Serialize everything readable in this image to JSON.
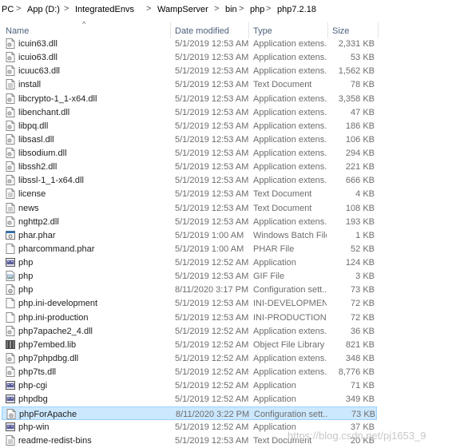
{
  "breadcrumb": [
    "PC",
    "App (D:)",
    "IntegratedEnvs",
    "WampServer",
    "bin",
    "php",
    "php7.2.18"
  ],
  "breadcrumb_separator": ">",
  "columns": {
    "name": "Name",
    "date": "Date modified",
    "type": "Type",
    "size": "Size"
  },
  "sort_indicator": "^",
  "files": [
    {
      "name": "icuin63.dll",
      "date": "5/1/2019 12:53 AM",
      "type": "Application extens...",
      "size": "2,331 KB",
      "icon": "dll-icon"
    },
    {
      "name": "icuio63.dll",
      "date": "5/1/2019 12:53 AM",
      "type": "Application extens...",
      "size": "53 KB",
      "icon": "dll-icon"
    },
    {
      "name": "icuuc63.dll",
      "date": "5/1/2019 12:53 AM",
      "type": "Application extens...",
      "size": "1,562 KB",
      "icon": "dll-icon"
    },
    {
      "name": "install",
      "date": "5/1/2019 12:53 AM",
      "type": "Text Document",
      "size": "78 KB",
      "icon": "text-document-icon"
    },
    {
      "name": "libcrypto-1_1-x64.dll",
      "date": "5/1/2019 12:53 AM",
      "type": "Application extens...",
      "size": "3,358 KB",
      "icon": "dll-icon"
    },
    {
      "name": "libenchant.dll",
      "date": "5/1/2019 12:53 AM",
      "type": "Application extens...",
      "size": "47 KB",
      "icon": "dll-icon"
    },
    {
      "name": "libpq.dll",
      "date": "5/1/2019 12:53 AM",
      "type": "Application extens...",
      "size": "186 KB",
      "icon": "dll-icon"
    },
    {
      "name": "libsasl.dll",
      "date": "5/1/2019 12:53 AM",
      "type": "Application extens...",
      "size": "106 KB",
      "icon": "dll-icon"
    },
    {
      "name": "libsodium.dll",
      "date": "5/1/2019 12:53 AM",
      "type": "Application extens...",
      "size": "294 KB",
      "icon": "dll-icon"
    },
    {
      "name": "libssh2.dll",
      "date": "5/1/2019 12:53 AM",
      "type": "Application extens...",
      "size": "221 KB",
      "icon": "dll-icon"
    },
    {
      "name": "libssl-1_1-x64.dll",
      "date": "5/1/2019 12:53 AM",
      "type": "Application extens...",
      "size": "666 KB",
      "icon": "dll-icon"
    },
    {
      "name": "license",
      "date": "5/1/2019 12:53 AM",
      "type": "Text Document",
      "size": "4 KB",
      "icon": "text-document-icon"
    },
    {
      "name": "news",
      "date": "5/1/2019 12:53 AM",
      "type": "Text Document",
      "size": "108 KB",
      "icon": "text-document-icon"
    },
    {
      "name": "nghttp2.dll",
      "date": "5/1/2019 12:53 AM",
      "type": "Application extens...",
      "size": "193 KB",
      "icon": "dll-icon"
    },
    {
      "name": "phar.phar",
      "date": "5/1/2019 1:00 AM",
      "type": "Windows Batch File",
      "size": "1 KB",
      "icon": "batch-file-icon"
    },
    {
      "name": "pharcommand.phar",
      "date": "5/1/2019 1:00 AM",
      "type": "PHAR File",
      "size": "52 KB",
      "icon": "blank-file-icon"
    },
    {
      "name": "php",
      "date": "5/1/2019 12:52 AM",
      "type": "Application",
      "size": "124 KB",
      "icon": "php-exe-icon"
    },
    {
      "name": "php",
      "date": "5/1/2019 12:53 AM",
      "type": "GIF File",
      "size": "3 KB",
      "icon": "gif-file-icon"
    },
    {
      "name": "php",
      "date": "8/11/2020 3:17 PM",
      "type": "Configuration sett...",
      "size": "73 KB",
      "icon": "config-file-icon"
    },
    {
      "name": "php.ini-development",
      "date": "5/1/2019 12:53 AM",
      "type": "INI-DEVELOPMEN...",
      "size": "72 KB",
      "icon": "blank-file-icon"
    },
    {
      "name": "php.ini-production",
      "date": "5/1/2019 12:53 AM",
      "type": "INI-PRODUCTION...",
      "size": "72 KB",
      "icon": "blank-file-icon"
    },
    {
      "name": "php7apache2_4.dll",
      "date": "5/1/2019 12:52 AM",
      "type": "Application extens...",
      "size": "36 KB",
      "icon": "dll-icon"
    },
    {
      "name": "php7embed.lib",
      "date": "5/1/2019 12:52 AM",
      "type": "Object File Library",
      "size": "821 KB",
      "icon": "lib-file-icon"
    },
    {
      "name": "php7phpdbg.dll",
      "date": "5/1/2019 12:52 AM",
      "type": "Application extens...",
      "size": "348 KB",
      "icon": "dll-icon"
    },
    {
      "name": "php7ts.dll",
      "date": "5/1/2019 12:52 AM",
      "type": "Application extens...",
      "size": "8,776 KB",
      "icon": "dll-icon"
    },
    {
      "name": "php-cgi",
      "date": "5/1/2019 12:52 AM",
      "type": "Application",
      "size": "71 KB",
      "icon": "php-exe-icon"
    },
    {
      "name": "phpdbg",
      "date": "5/1/2019 12:52 AM",
      "type": "Application",
      "size": "349 KB",
      "icon": "php-exe-icon"
    },
    {
      "name": "phpForApache",
      "date": "8/11/2020 3:22 PM",
      "type": "Configuration sett...",
      "size": "73 KB",
      "icon": "config-file-icon",
      "selected": true
    },
    {
      "name": "php-win",
      "date": "5/1/2019 12:52 AM",
      "type": "Application",
      "size": "37 KB",
      "icon": "php-exe-icon"
    },
    {
      "name": "readme-redist-bins",
      "date": "5/1/2019 12:53 AM",
      "type": "Text Document",
      "size": "20 KB",
      "icon": "text-document-icon"
    }
  ],
  "watermark": "https://blog.csdn.net/pj1653_9",
  "colors": {
    "selection_bg": "#cce8ff",
    "selection_border": "#99d1ff",
    "header_text": "#4c607a"
  }
}
